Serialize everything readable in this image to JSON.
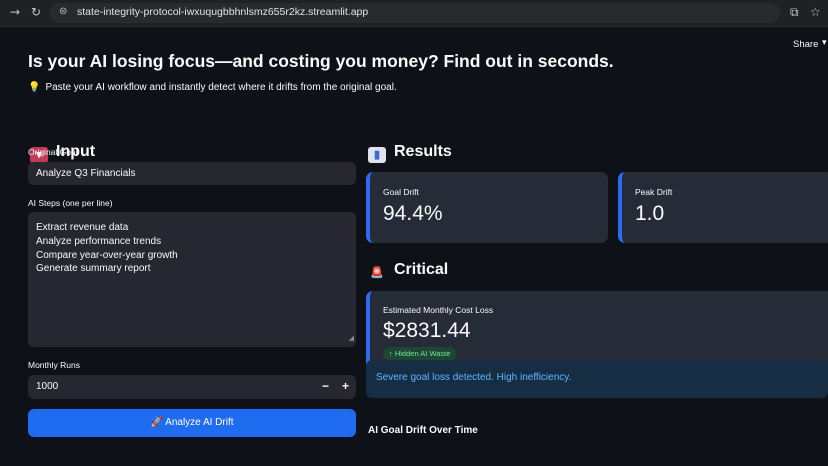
{
  "browser": {
    "url": "state-integrity-protocol-iwxuqugbbhnlsmz655r2kz.streamlit.app",
    "back_icon": "arrow-right-icon",
    "reload_icon": "reload-icon"
  },
  "header": {
    "share_label": "Share"
  },
  "page": {
    "title": "Is your AI losing focus—and costing you money? Find out in seconds.",
    "subtitle": "Paste your AI workflow and instantly detect where it drifts from the original goal."
  },
  "input_section": {
    "heading": "Input",
    "goal_label": "Original Goal",
    "goal_value": "Analyze Q3 Financials",
    "steps_label": "AI Steps (one per line)",
    "steps_value": "Extract revenue data\nAnalyze performance trends\nCompare year-over-year growth\nGenerate summary report",
    "runs_label": "Monthly Runs",
    "runs_value": "1000",
    "minus": "−",
    "plus": "+",
    "analyze_button": "Analyze AI Drift"
  },
  "results_section": {
    "heading": "Results",
    "goal_drift_label": "Goal Drift",
    "goal_drift_value": "94.4%",
    "peak_drift_label": "Peak Drift",
    "peak_drift_value": "1.0"
  },
  "critical_section": {
    "heading": "Critical",
    "cost_label": "Estimated Monthly Cost Loss",
    "cost_value": "$2831.44",
    "delta_label": "Hidden AI Waste",
    "alert_text": "Severe goal loss detected. High inefficiency.",
    "chart_heading": "AI Goal Drift Over Time"
  },
  "colors": {
    "accent": "#1f6cf0",
    "card_border": "#2f6bf2",
    "info_text": "#60b4ff",
    "delta_text": "#6ee7a2"
  }
}
